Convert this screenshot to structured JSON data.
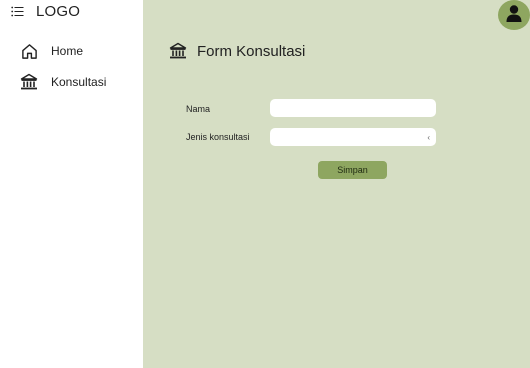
{
  "brand": {
    "logo_text": "LOGO",
    "menu_icon": "list-menu-icon"
  },
  "sidebar": {
    "items": [
      {
        "label": "Home",
        "icon": "home-icon"
      },
      {
        "label": "Konsultasi",
        "icon": "bank-icon"
      }
    ]
  },
  "header": {
    "avatar_icon": "user-icon"
  },
  "form": {
    "title": "Form Konsultasi",
    "title_icon": "bank-icon",
    "fields": {
      "nama": {
        "label": "Nama",
        "value": ""
      },
      "jenis": {
        "label": "Jenis konsultasi",
        "value": ""
      }
    },
    "submit_label": "Simpan"
  },
  "colors": {
    "main_bg": "#d6dec4",
    "accent": "#8ea660",
    "sidebar_bg": "#ffffff",
    "input_bg": "#ffffff"
  }
}
